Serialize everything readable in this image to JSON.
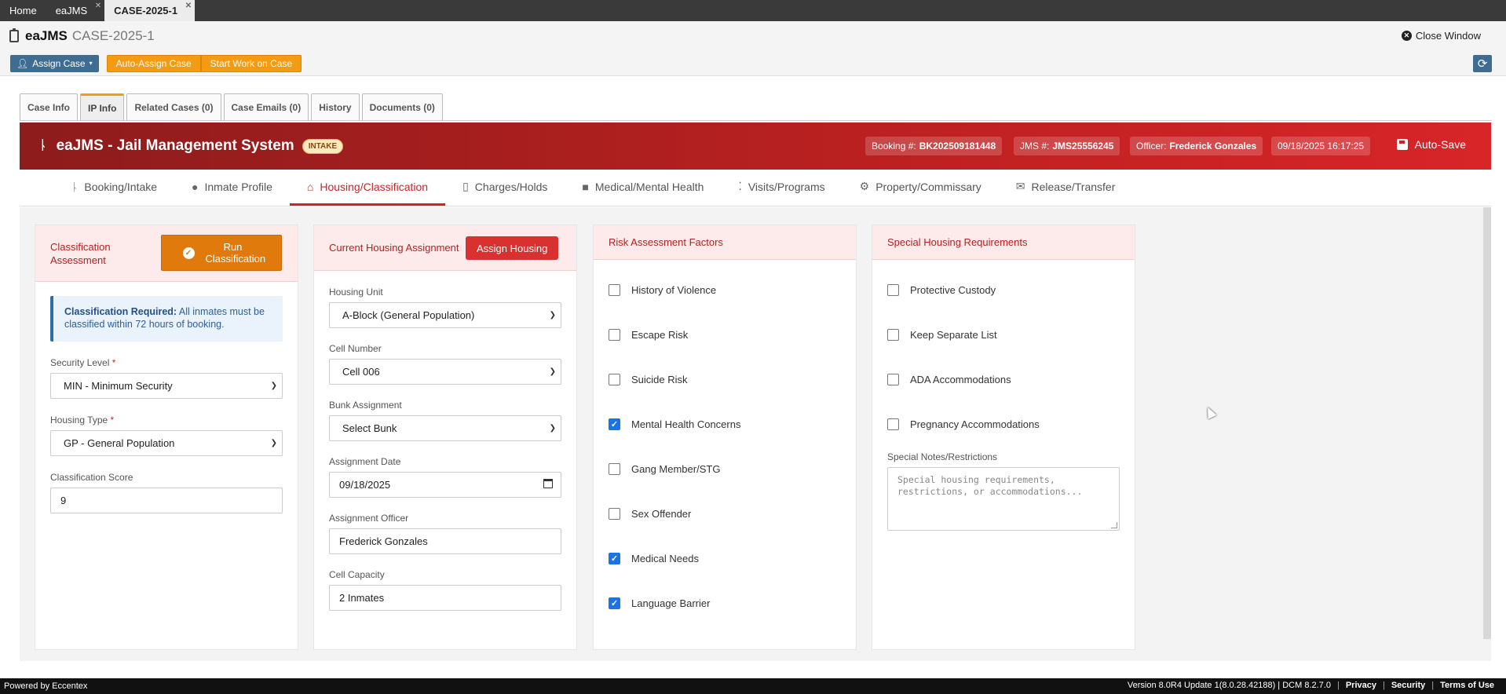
{
  "top_tabs": [
    {
      "label": "Home"
    },
    {
      "label": "eaJMS"
    },
    {
      "label": "CASE-2025-1"
    }
  ],
  "title_bar": {
    "app_name": "eaJMS",
    "case_id": "CASE-2025-1",
    "close_window": "Close Window"
  },
  "action_bar": {
    "assign_case": "Assign Case",
    "auto_assign": "Auto-Assign Case",
    "start_work": "Start Work on Case"
  },
  "case_tabs": [
    "Case Info",
    "IP Info",
    "Related Cases (0)",
    "Case Emails (0)",
    "History",
    "Documents (0)"
  ],
  "header": {
    "title": "eaJMS - Jail Management System",
    "badge": "INTAKE",
    "booking_label": "Booking #:",
    "booking_value": "BK202509181448",
    "jms_label": "JMS #:",
    "jms_value": "JMS25556245",
    "officer_label": "Officer:",
    "officer_value": "Frederick Gonzales",
    "datetime": "09/18/2025 16:17:25",
    "autosave": "Auto-Save"
  },
  "module_tabs": [
    "Booking/Intake",
    "Inmate Profile",
    "Housing/Classification",
    "Charges/Holds",
    "Medical/Mental Health",
    "Visits/Programs",
    "Property/Commissary",
    "Release/Transfer"
  ],
  "classification": {
    "title": "Classification Assessment",
    "run_button": "Run Classification",
    "alert_bold": "Classification Required:",
    "alert_text": "All inmates must be classified within 72 hours of booking.",
    "security_label": "Security Level",
    "security_value": "MIN - Minimum Security",
    "housing_type_label": "Housing Type",
    "housing_type_value": "GP - General Population",
    "score_label": "Classification Score",
    "score_value": "9"
  },
  "housing": {
    "title": "Current Housing Assignment",
    "assign_button": "Assign Housing",
    "unit_label": "Housing Unit",
    "unit_value": "A-Block (General Population)",
    "cell_label": "Cell Number",
    "cell_value": "Cell 006",
    "bunk_label": "Bunk Assignment",
    "bunk_value": "Select Bunk",
    "date_label": "Assignment Date",
    "date_value": "09/18/2025",
    "officer_label": "Assignment Officer",
    "officer_value": "Frederick Gonzales",
    "capacity_label": "Cell Capacity",
    "capacity_value": "2 Inmates"
  },
  "risk": {
    "title": "Risk Assessment Factors",
    "items": [
      {
        "label": "History of Violence",
        "checked": false
      },
      {
        "label": "Escape Risk",
        "checked": false
      },
      {
        "label": "Suicide Risk",
        "checked": false
      },
      {
        "label": "Mental Health Concerns",
        "checked": true
      },
      {
        "label": "Gang Member/STG",
        "checked": false
      },
      {
        "label": "Sex Offender",
        "checked": false
      },
      {
        "label": "Medical Needs",
        "checked": true
      },
      {
        "label": "Language Barrier",
        "checked": true
      }
    ]
  },
  "special": {
    "title": "Special Housing Requirements",
    "items": [
      {
        "label": "Protective Custody",
        "checked": false
      },
      {
        "label": "Keep Separate List",
        "checked": false
      },
      {
        "label": "ADA Accommodations",
        "checked": false
      },
      {
        "label": "Pregnancy Accommodations",
        "checked": false
      }
    ],
    "notes_label": "Special Notes/Restrictions",
    "notes_placeholder": "Special housing requirements, restrictions, or accommodations..."
  },
  "footer": {
    "powered": "Powered by Eccentex",
    "version": "Version  8.0R4 Update 1(8.0.28.42188) | DCM 8.2.7.0",
    "privacy": "Privacy",
    "security": "Security",
    "terms": "Terms of Use"
  }
}
